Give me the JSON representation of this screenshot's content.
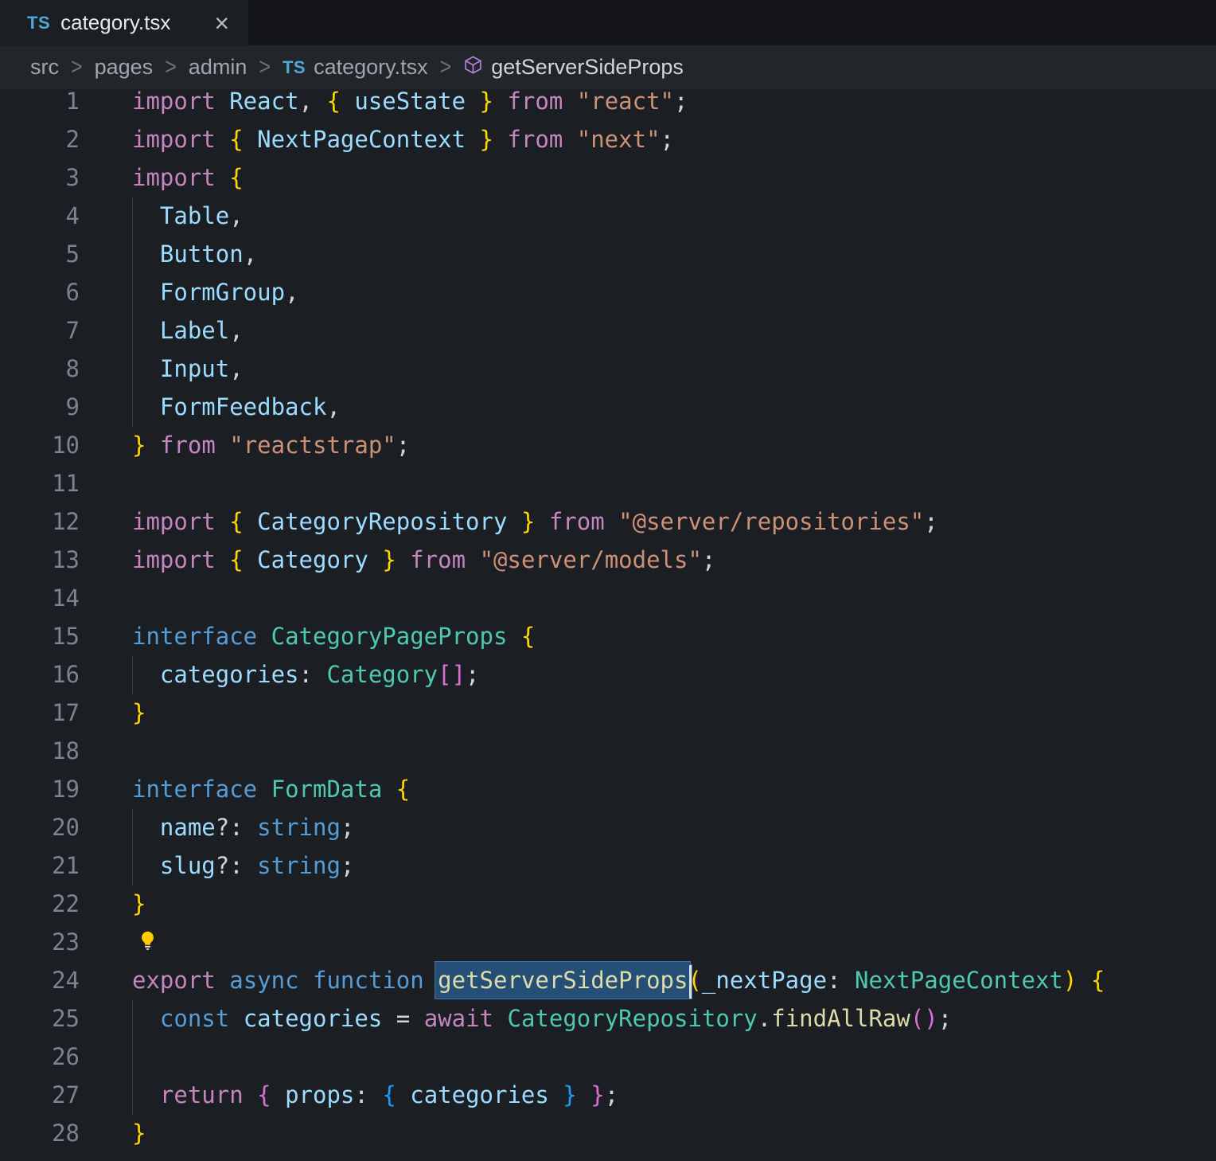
{
  "tab": {
    "icon_label": "TS",
    "label": "category.tsx",
    "close_glyph": "×"
  },
  "breadcrumb": {
    "items": [
      "src",
      "pages",
      "admin"
    ],
    "separator": ">",
    "file": {
      "icon_label": "TS",
      "label": "category.tsx"
    },
    "symbol": "getServerSideProps"
  },
  "palette": {
    "k": "#c586c0",
    "b": "#569cd6",
    "t": "#4ec9b0",
    "v": "#9cdcfe",
    "f": "#dcdcaa",
    "s": "#ce9178",
    "p": "#d4d4d4",
    "g1": "#ffd700",
    "g2": "#da70d6",
    "g3": "#179fff"
  },
  "editor": {
    "lines": [
      {
        "n": 1,
        "tk": [
          [
            "import",
            "k"
          ],
          [
            " React",
            "v"
          ],
          [
            ", ",
            "p"
          ],
          [
            "{",
            "g1"
          ],
          [
            " useState ",
            "v"
          ],
          [
            "}",
            "g1"
          ],
          [
            " ",
            "p"
          ],
          [
            "from",
            "k"
          ],
          [
            " ",
            "p"
          ],
          [
            "\"react\"",
            "s"
          ],
          [
            ";",
            "p"
          ]
        ]
      },
      {
        "n": 2,
        "tk": [
          [
            "import",
            "k"
          ],
          [
            " ",
            "p"
          ],
          [
            "{",
            "g1"
          ],
          [
            " NextPageContext ",
            "v"
          ],
          [
            "}",
            "g1"
          ],
          [
            " ",
            "p"
          ],
          [
            "from",
            "k"
          ],
          [
            " ",
            "p"
          ],
          [
            "\"next\"",
            "s"
          ],
          [
            ";",
            "p"
          ]
        ]
      },
      {
        "n": 3,
        "tk": [
          [
            "import",
            "k"
          ],
          [
            " ",
            "p"
          ],
          [
            "{",
            "g1"
          ]
        ]
      },
      {
        "n": 4,
        "tk": [
          [
            "  Table",
            "v"
          ],
          [
            ",",
            "p"
          ]
        ]
      },
      {
        "n": 5,
        "tk": [
          [
            "  Button",
            "v"
          ],
          [
            ",",
            "p"
          ]
        ]
      },
      {
        "n": 6,
        "tk": [
          [
            "  FormGroup",
            "v"
          ],
          [
            ",",
            "p"
          ]
        ]
      },
      {
        "n": 7,
        "tk": [
          [
            "  Label",
            "v"
          ],
          [
            ",",
            "p"
          ]
        ]
      },
      {
        "n": 8,
        "tk": [
          [
            "  Input",
            "v"
          ],
          [
            ",",
            "p"
          ]
        ]
      },
      {
        "n": 9,
        "tk": [
          [
            "  FormFeedback",
            "v"
          ],
          [
            ",",
            "p"
          ]
        ]
      },
      {
        "n": 10,
        "tk": [
          [
            "}",
            "g1"
          ],
          [
            " ",
            "p"
          ],
          [
            "from",
            "k"
          ],
          [
            " ",
            "p"
          ],
          [
            "\"reactstrap\"",
            "s"
          ],
          [
            ";",
            "p"
          ]
        ]
      },
      {
        "n": 11,
        "tk": []
      },
      {
        "n": 12,
        "tk": [
          [
            "import",
            "k"
          ],
          [
            " ",
            "p"
          ],
          [
            "{",
            "g1"
          ],
          [
            " CategoryRepository ",
            "v"
          ],
          [
            "}",
            "g1"
          ],
          [
            " ",
            "p"
          ],
          [
            "from",
            "k"
          ],
          [
            " ",
            "p"
          ],
          [
            "\"@server/repositories\"",
            "s"
          ],
          [
            ";",
            "p"
          ]
        ]
      },
      {
        "n": 13,
        "tk": [
          [
            "import",
            "k"
          ],
          [
            " ",
            "p"
          ],
          [
            "{",
            "g1"
          ],
          [
            " Category ",
            "v"
          ],
          [
            "}",
            "g1"
          ],
          [
            " ",
            "p"
          ],
          [
            "from",
            "k"
          ],
          [
            " ",
            "p"
          ],
          [
            "\"@server/models\"",
            "s"
          ],
          [
            ";",
            "p"
          ]
        ]
      },
      {
        "n": 14,
        "tk": []
      },
      {
        "n": 15,
        "tk": [
          [
            "interface",
            "b"
          ],
          [
            " ",
            "p"
          ],
          [
            "CategoryPageProps",
            "t"
          ],
          [
            " ",
            "p"
          ],
          [
            "{",
            "g1"
          ]
        ]
      },
      {
        "n": 16,
        "tk": [
          [
            "  categories",
            "v"
          ],
          [
            ": ",
            "p"
          ],
          [
            "Category",
            "t"
          ],
          [
            "[]",
            "g2"
          ],
          [
            ";",
            "p"
          ]
        ]
      },
      {
        "n": 17,
        "tk": [
          [
            "}",
            "g1"
          ]
        ]
      },
      {
        "n": 18,
        "tk": []
      },
      {
        "n": 19,
        "tk": [
          [
            "interface",
            "b"
          ],
          [
            " ",
            "p"
          ],
          [
            "FormData",
            "t"
          ],
          [
            " ",
            "p"
          ],
          [
            "{",
            "g1"
          ]
        ]
      },
      {
        "n": 20,
        "tk": [
          [
            "  name",
            "v"
          ],
          [
            "?: ",
            "p"
          ],
          [
            "string",
            "b"
          ],
          [
            ";",
            "p"
          ]
        ]
      },
      {
        "n": 21,
        "tk": [
          [
            "  slug",
            "v"
          ],
          [
            "?: ",
            "p"
          ],
          [
            "string",
            "b"
          ],
          [
            ";",
            "p"
          ]
        ]
      },
      {
        "n": 22,
        "tk": [
          [
            "}",
            "g1"
          ]
        ]
      },
      {
        "n": 23,
        "tk": [],
        "bulb": true
      },
      {
        "n": 24,
        "tk": [
          [
            "export",
            "k"
          ],
          [
            " ",
            "p"
          ],
          [
            "async",
            "b"
          ],
          [
            " ",
            "p"
          ],
          [
            "function",
            "b"
          ],
          [
            " ",
            "p"
          ],
          [
            "getServerSideProps",
            "f",
            "hl"
          ],
          [
            "(",
            "g1"
          ],
          [
            "_nextPage",
            "v"
          ],
          [
            ": ",
            "p"
          ],
          [
            "NextPageContext",
            "t"
          ],
          [
            ")",
            "g1"
          ],
          [
            " ",
            "p"
          ],
          [
            "{",
            "g1"
          ]
        ]
      },
      {
        "n": 25,
        "tk": [
          [
            "  ",
            "p"
          ],
          [
            "const",
            "b"
          ],
          [
            " ",
            "p"
          ],
          [
            "categories",
            "v"
          ],
          [
            " = ",
            "p"
          ],
          [
            "await",
            "k"
          ],
          [
            " ",
            "p"
          ],
          [
            "CategoryRepository",
            "t"
          ],
          [
            ".",
            "p"
          ],
          [
            "findAllRaw",
            "f"
          ],
          [
            "()",
            "g2"
          ],
          [
            ";",
            "p"
          ]
        ]
      },
      {
        "n": 26,
        "tk": [],
        "g": true
      },
      {
        "n": 27,
        "tk": [
          [
            "  ",
            "p"
          ],
          [
            "return",
            "k"
          ],
          [
            " ",
            "p"
          ],
          [
            "{",
            "g2"
          ],
          [
            " ",
            "p"
          ],
          [
            "props",
            "v"
          ],
          [
            ": ",
            "p"
          ],
          [
            "{",
            "g3"
          ],
          [
            " categories ",
            "v"
          ],
          [
            "}",
            "g3"
          ],
          [
            " ",
            "p"
          ],
          [
            "}",
            "g2"
          ],
          [
            ";",
            "p"
          ]
        ]
      },
      {
        "n": 28,
        "tk": [
          [
            "}",
            "g1"
          ]
        ]
      }
    ]
  }
}
